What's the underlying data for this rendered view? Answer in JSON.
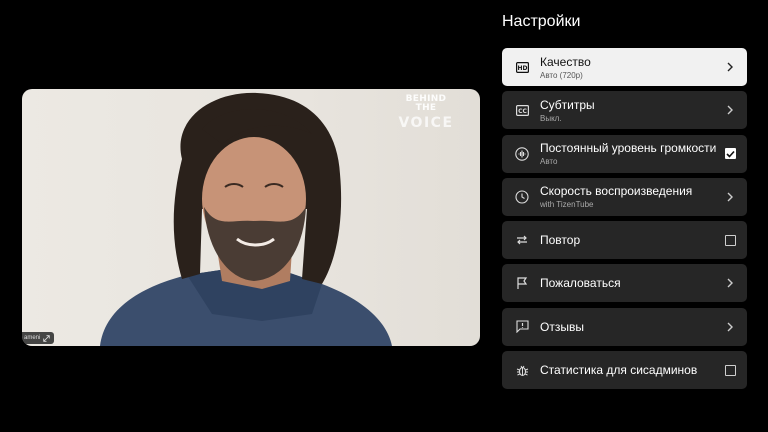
{
  "video": {
    "watermark_line1": "BEHIND THE",
    "watermark_line2": "VOICE",
    "camera_label": "ameni"
  },
  "settings": {
    "title": "Настройки",
    "items": [
      {
        "id": "quality",
        "label": "Качество",
        "sub": "Авто (720p)",
        "icon": "hd-icon",
        "trailing": "chevron",
        "active": true
      },
      {
        "id": "subtitles",
        "label": "Субтитры",
        "sub": "Выкл.",
        "icon": "cc-icon",
        "trailing": "chevron"
      },
      {
        "id": "volume",
        "label": "Постоянный уровень громкости",
        "sub": "Авто",
        "icon": "audio-level-icon",
        "trailing": "checkbox",
        "checked": true
      },
      {
        "id": "speed",
        "label": "Скорость воспроизведения",
        "sub": "with TizenTube",
        "icon": "clock-icon",
        "trailing": "chevron"
      },
      {
        "id": "repeat",
        "label": "Повтор",
        "sub": "",
        "icon": "repeat-icon",
        "trailing": "checkbox",
        "checked": false
      },
      {
        "id": "report",
        "label": "Пожаловаться",
        "sub": "",
        "icon": "flag-icon",
        "trailing": "chevron"
      },
      {
        "id": "feedback",
        "label": "Отзывы",
        "sub": "",
        "icon": "feedback-icon",
        "trailing": "chevron"
      },
      {
        "id": "stats",
        "label": "Статистика для сисадминов",
        "sub": "",
        "icon": "bug-icon",
        "trailing": "checkbox",
        "checked": false
      }
    ]
  },
  "colors": {
    "item_bg": "#262626",
    "active_bg": "#f1f1f1"
  }
}
